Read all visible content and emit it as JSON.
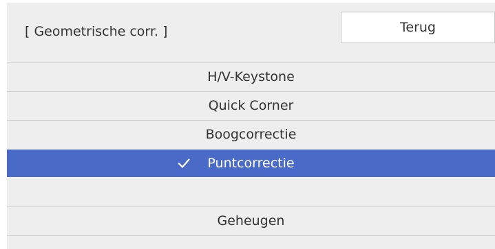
{
  "header": {
    "title": "[ Geometrische corr. ]",
    "back_label": "Terug"
  },
  "menu": {
    "items": [
      {
        "label": "H/V-Keystone",
        "selected": false
      },
      {
        "label": "Quick Corner",
        "selected": false
      },
      {
        "label": "Boogcorrectie",
        "selected": false
      },
      {
        "label": "Puntcorrectie",
        "selected": true,
        "icon": "checkmark-icon"
      }
    ],
    "memory_label": "Geheugen"
  },
  "colors": {
    "panel_background": "#eeeeee",
    "selected_background": "#4a6ac8",
    "selected_text": "#ffffff",
    "text": "#333333"
  }
}
